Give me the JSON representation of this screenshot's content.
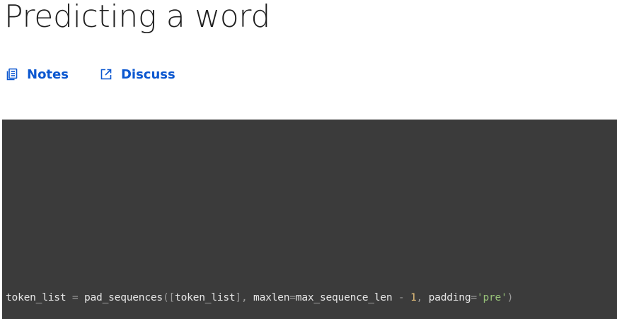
{
  "page": {
    "title": "Predicting a word"
  },
  "links": {
    "notes": {
      "label": "Notes",
      "icon": "notes-icon"
    },
    "discuss": {
      "label": "Discuss",
      "icon": "external-link-icon"
    }
  },
  "video": {
    "background": "#3b3b3b",
    "code_tokens": {
      "t1": "token_list",
      "t2": " = ",
      "t3": "pad_sequences",
      "t4": "([",
      "t5": "token_list",
      "t6": "], ",
      "t7": "maxlen",
      "t8": "=",
      "t9": "max_sequence_len",
      "t10": " - ",
      "t11": "1",
      "t12": ", ",
      "t13": "padding",
      "t14": "=",
      "t15": "'pre'",
      "t16": ")"
    }
  },
  "colors": {
    "link": "#0b57d0",
    "title": "#1f1f1f",
    "code_text": "#e6e6e6",
    "code_number": "#e5c07b",
    "code_string": "#98c379"
  }
}
